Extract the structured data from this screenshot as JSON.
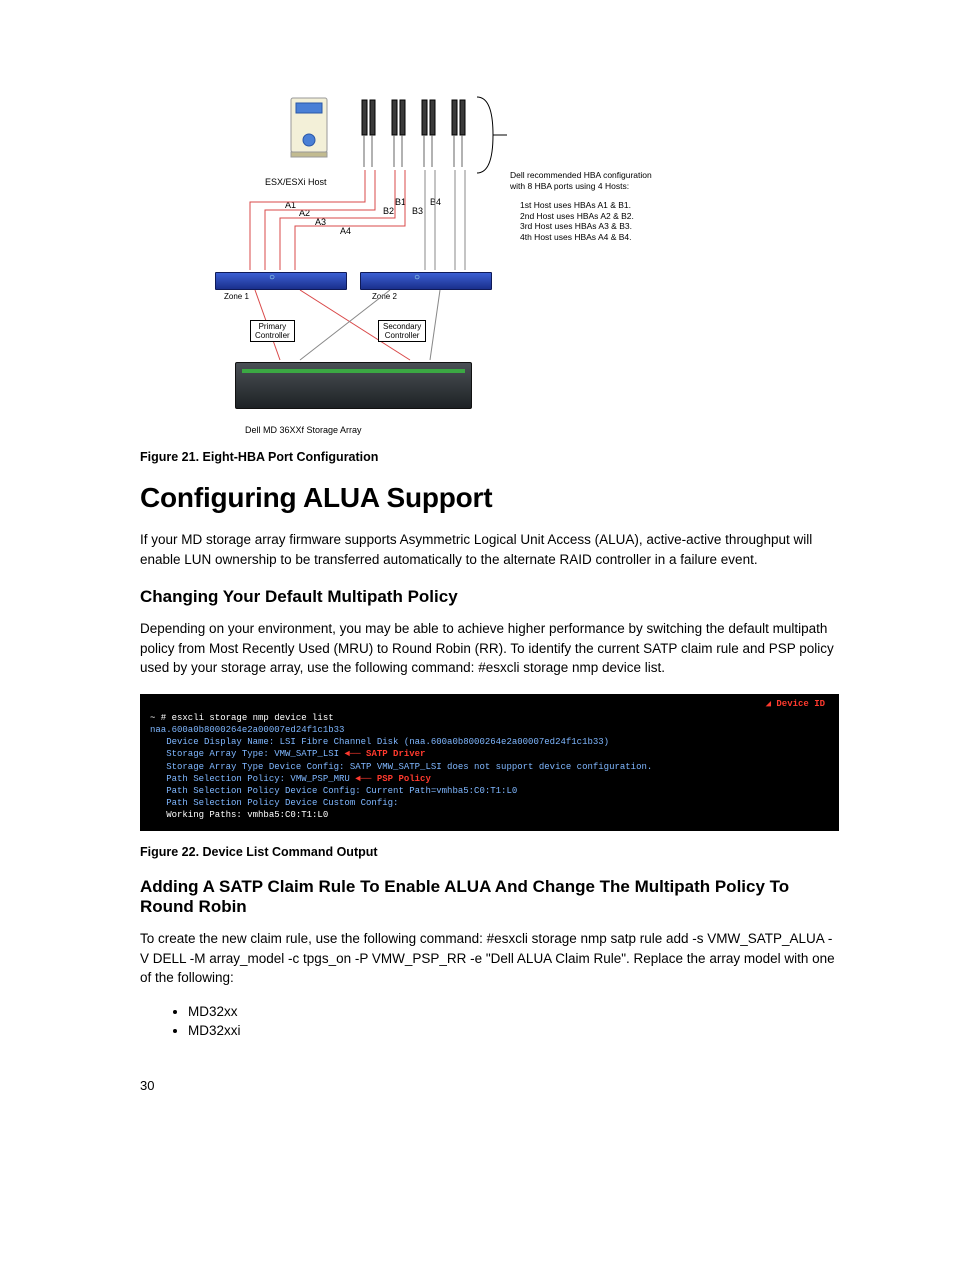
{
  "diagram": {
    "host_label": "ESX/ESXi Host",
    "hba_rec": "Dell recommended HBA configuration\nwith 8 HBA ports using 4 Hosts:",
    "hba_rows": [
      "1st Host uses HBAs A1 & B1.",
      "2nd Host uses HBAs A2 & B2.",
      "3rd Host uses HBAs A3 & B3.",
      "4th Host uses HBAs A4 & B4."
    ],
    "port_labels": {
      "a1": "A1",
      "a2": "A2",
      "a3": "A3",
      "a4": "A4",
      "b1": "B1",
      "b2": "B2",
      "b3": "B3",
      "b4": "B4"
    },
    "zone1": "Zone 1",
    "zone2": "Zone 2",
    "primary": "Primary\nController",
    "secondary": "Secondary\nController",
    "storage_caption": "Dell MD 36XXf Storage Array"
  },
  "fig21": "Figure 21. Eight-HBA Port Configuration",
  "h1": "Configuring ALUA Support",
  "p1": "If your MD storage array firmware supports Asymmetric Logical Unit Access (ALUA), active-active throughput will enable LUN ownership to be transferred automatically to the alternate RAID controller in a failure event.",
  "h2a": "Changing Your Default Multipath Policy",
  "p2_pre": "Depending on your environment, you may be able to achieve higher performance by switching the default multipath policy from Most Recently Used (MRU) to Round Robin (RR). To identify the current SATP claim rule and PSP policy used by your storage array, use the following command: ",
  "p2_cmd": "#esxcli storage nmp device list",
  "terminal": {
    "l1": "~ # esxcli storage nmp device list",
    "l2": "naa.600a0b8000264e2a00007ed24f1c1b33",
    "l3": "   Device Display Name: LSI Fibre Channel Disk (naa.600a0b8000264e2a00007ed24f1c1b33)",
    "l4a": "   Storage Array Type: VMW_SATP_LSI ",
    "l4b": "◄── SATP Driver",
    "l5": "   Storage Array Type Device Config: SATP VMW_SATP_LSI does not support device configuration.",
    "l6a": "   Path Selection Policy: VMW_PSP_MRU ",
    "l6b": "◄── PSP Policy",
    "l7": "   Path Selection Policy Device Config: Current Path=vmhba5:C0:T1:L0",
    "l8": "   Path Selection Policy Device Custom Config:",
    "l9": "   Working Paths: vmhba5:C0:T1:L0",
    "dev_lbl": "Device ID",
    "arrow": "◢"
  },
  "fig22": "Figure 22. Device List Command Output",
  "h2b": "Adding A SATP Claim Rule To Enable ALUA And Change The Multipath Policy To Round Robin",
  "p3_pre": "To create the new claim rule, use the following command: ",
  "p3_cmd": "#esxcli storage nmp satp rule add -s VMW_SATP_ALUA -V DELL -M array_model -c tpgs_on -P VMW_PSP_RR -e \"Dell ALUA Claim Rule\"",
  "p3_post": ". Replace the array model with one of the following:",
  "bullets": [
    "MD32xx",
    "MD32xxi"
  ],
  "page_num": "30"
}
